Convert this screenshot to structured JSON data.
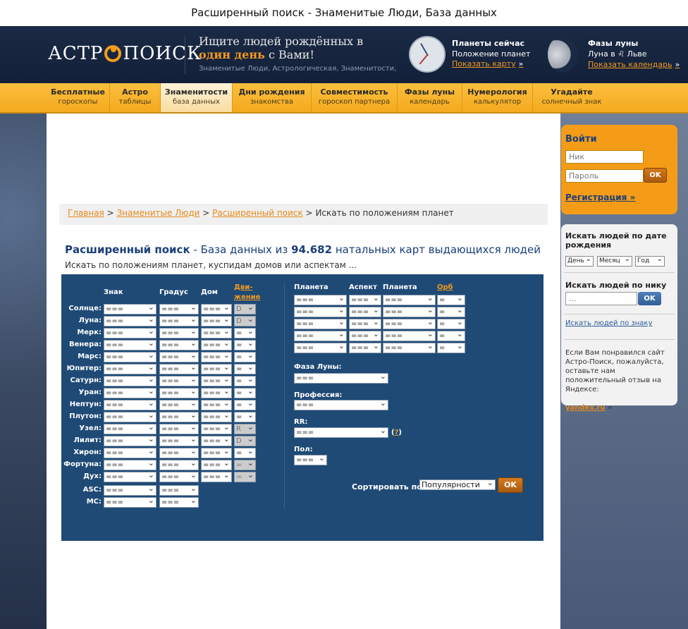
{
  "window_title": "Расширенный поиск - Знаменитые Люди, База данных",
  "header": {
    "logo_left": "АСТР",
    "logo_right": "ПОИСК",
    "slogan_line1": "Ищите людей рождённых в",
    "slogan_highlight": "один день",
    "slogan_line2_rest": " с Вами!",
    "slogan_small": "Знаменитые Люди, Астрологическая, Знаменитости,",
    "planets_title": "Планеты сейчас",
    "planets_sub": "Положение планет",
    "planets_link": "Показать карту",
    "moon_title": "Фазы луны",
    "moon_sub": "Луна в ♌ Льве",
    "moon_link": "Показать календарь",
    "arrow": "»"
  },
  "nav": [
    {
      "title": "Бесплатные",
      "sub": "гороскопы"
    },
    {
      "title": "Астро",
      "sub": "таблицы"
    },
    {
      "title": "Знаменитости",
      "sub": "база данных"
    },
    {
      "title": "Дни рождения",
      "sub": "знакомства"
    },
    {
      "title": "Совместимость",
      "sub": "гороскоп партнера"
    },
    {
      "title": "Фазы луны",
      "sub": "календарь"
    },
    {
      "title": "Нумерология",
      "sub": "калькулятор"
    },
    {
      "title": "Угадайте",
      "sub": "солнечный знак"
    }
  ],
  "breadcrumb": {
    "home": "Главная",
    "famous": "Знаменитые Люди",
    "advanced": "Расширенный поиск",
    "sep": ">",
    "current": "Искать по положениям планет"
  },
  "heading": {
    "title": "Расширенный поиск",
    "dash": " - База данных из ",
    "count": "94.682",
    "tail": " натальных карт выдающихся людей"
  },
  "subtitle": "Искать по положениям планет, куспидам домов или аспектам ...",
  "form": {
    "col_sign": "Знак",
    "col_degree": "Градус",
    "col_house": "Дом",
    "col_motion_a": "Дви-",
    "col_motion_b": "жение",
    "col_planet1": "Планета",
    "col_aspect": "Аспект",
    "col_planet2": "Планета",
    "col_orb": "Орб",
    "placeholder": "===",
    "eq": "=",
    "D": "D",
    "R": "R",
    "planets": [
      {
        "name": "Солнце:",
        "motion": "D",
        "motion_disabled": true
      },
      {
        "name": "Луна:",
        "motion": "D",
        "motion_disabled": true
      },
      {
        "name": "Мерк:",
        "motion": "=",
        "motion_disabled": false
      },
      {
        "name": "Венера:",
        "motion": "=",
        "motion_disabled": false
      },
      {
        "name": "Марс:",
        "motion": "=",
        "motion_disabled": false
      },
      {
        "name": "Юпитер:",
        "motion": "=",
        "motion_disabled": false
      },
      {
        "name": "Сатурн:",
        "motion": "=",
        "motion_disabled": false
      },
      {
        "name": "Уран:",
        "motion": "=",
        "motion_disabled": false
      },
      {
        "name": "Нептун:",
        "motion": "=",
        "motion_disabled": false
      },
      {
        "name": "Плутон:",
        "motion": "=",
        "motion_disabled": false
      },
      {
        "name": "Узел:",
        "motion": "R",
        "motion_disabled": true
      },
      {
        "name": "Лилит:",
        "motion": "D",
        "motion_disabled": true
      },
      {
        "name": "Хирон:",
        "motion": "=",
        "motion_disabled": false
      },
      {
        "name": "Фортуна:",
        "motion": "=",
        "motion_disabled": true
      },
      {
        "name": "Дух:",
        "motion": "=",
        "motion_disabled": true
      }
    ],
    "angles": [
      "ASC:",
      "MC:"
    ],
    "moon_phase_label": "Фаза Луны:",
    "profession_label": "Профессия:",
    "rr_label": "RR:",
    "rr_help": "?",
    "gender_label": "Пол:",
    "sort_label": "Сортировать по:",
    "sort_value": "Популярности",
    "ok": "OK"
  },
  "sidebar": {
    "login_title": "Войти",
    "nick_placeholder": "Ник",
    "pass_placeholder": "Пароль",
    "ok": "OK",
    "register": "Регистрация",
    "register_arrow": "»",
    "by_date_title": "Искать людей по дате рождения",
    "day": "День",
    "month": "Месяц",
    "year": "Год",
    "by_nick_title": "Искать людей по нику",
    "nick_input": "...",
    "by_sign_link": "Искать людей по знаку",
    "yandex_text": "Если Вам понравился сайт Астро-Поиск, пожалуйста, оставьте нам положительный отзыв на Яндексе:",
    "yandex_link": "yandex.ru",
    "yandex_arrow": "»"
  }
}
